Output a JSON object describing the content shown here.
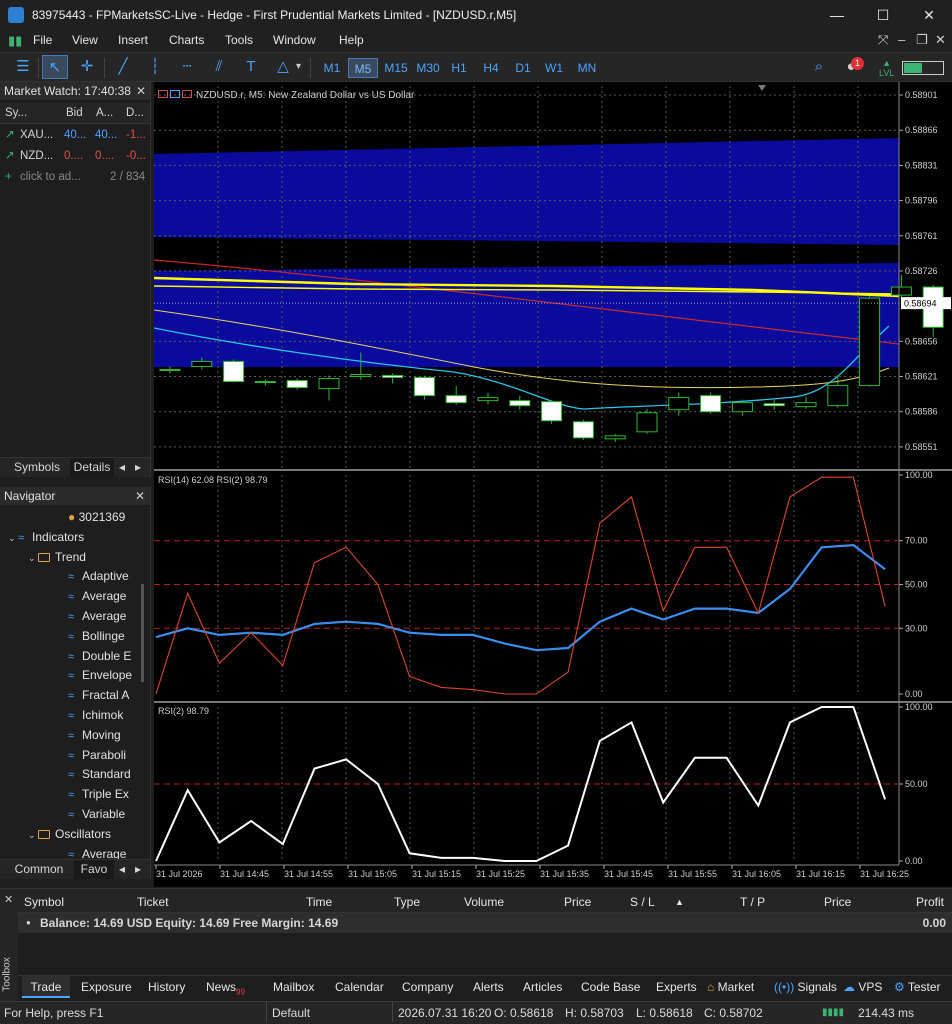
{
  "window": {
    "title": "83975443 - FPMarketsSC-Live - Hedge - First Prudential Markets Limited - [NZDUSD.r,M5]",
    "minimize": "—",
    "maximize": "☐",
    "close": "✕"
  },
  "menu": [
    "File",
    "View",
    "Insert",
    "Charts",
    "Tools",
    "Window",
    "Help"
  ],
  "toolbar": {
    "timeframes": [
      "M1",
      "M5",
      "M15",
      "M30",
      "H1",
      "H4",
      "D1",
      "W1",
      "MN"
    ],
    "selected_timeframe": "M5",
    "notification_count": "1",
    "lvl_label": "LVL"
  },
  "market_watch": {
    "title": "Market Watch: 17:40:38",
    "columns": [
      "Sy...",
      "Bid",
      "A...",
      "D..."
    ],
    "rows": [
      {
        "symbol": "XAU...",
        "bid": "40...",
        "ask": "40...",
        "daily": "-1...",
        "color": "#4aa3ff"
      },
      {
        "symbol": "NZD...",
        "bid": "0....",
        "ask": "0....",
        "daily": "-0...",
        "color": "#e05050"
      }
    ],
    "add_row": "click to ad...",
    "count": "2 / 834",
    "tabs": [
      "Symbols",
      "Details"
    ]
  },
  "navigator": {
    "title": "Navigator",
    "account": "3021369",
    "items": [
      {
        "label": "Indicators",
        "kind": "root"
      },
      {
        "label": "Trend",
        "kind": "folder"
      },
      {
        "label": "Adaptive",
        "kind": "ind"
      },
      {
        "label": "Average",
        "kind": "ind"
      },
      {
        "label": "Average",
        "kind": "ind"
      },
      {
        "label": "Bollinge",
        "kind": "ind"
      },
      {
        "label": "Double E",
        "kind": "ind"
      },
      {
        "label": "Envelope",
        "kind": "ind"
      },
      {
        "label": "Fractal A",
        "kind": "ind"
      },
      {
        "label": "Ichimok",
        "kind": "ind"
      },
      {
        "label": "Moving",
        "kind": "ind"
      },
      {
        "label": "Paraboli",
        "kind": "ind"
      },
      {
        "label": "Standard",
        "kind": "ind"
      },
      {
        "label": "Triple Ex",
        "kind": "ind"
      },
      {
        "label": "Variable",
        "kind": "ind"
      },
      {
        "label": "Oscillators",
        "kind": "folder"
      },
      {
        "label": "Average",
        "kind": "ind"
      }
    ],
    "tabs": [
      "Common",
      "Favo"
    ]
  },
  "chart_data": [
    {
      "type": "candlestick",
      "title": "NZDUSD.r, M5:  New Zealand Dollar vs US Dollar",
      "current_price": "0.58694",
      "y_ticks": [
        "0.58901",
        "0.58866",
        "0.58831",
        "0.58796",
        "0.58761",
        "0.58726",
        "0.58656",
        "0.58621",
        "0.58586",
        "0.58551"
      ],
      "ylim": [
        0.5853,
        0.5891
      ],
      "candles": [
        {
          "o": 0.58627,
          "h": 0.58631,
          "l": 0.58624,
          "c": 0.58628
        },
        {
          "o": 0.58631,
          "h": 0.5864,
          "l": 0.58628,
          "c": 0.58636
        },
        {
          "o": 0.58636,
          "h": 0.58638,
          "l": 0.58615,
          "c": 0.58616
        },
        {
          "o": 0.58616,
          "h": 0.58618,
          "l": 0.58612,
          "c": 0.58615
        },
        {
          "o": 0.58617,
          "h": 0.58619,
          "l": 0.58608,
          "c": 0.5861
        },
        {
          "o": 0.58609,
          "h": 0.58622,
          "l": 0.58597,
          "c": 0.58619
        },
        {
          "o": 0.58621,
          "h": 0.58645,
          "l": 0.58618,
          "c": 0.58623
        },
        {
          "o": 0.58622,
          "h": 0.58624,
          "l": 0.58614,
          "c": 0.5862
        },
        {
          "o": 0.5862,
          "h": 0.58622,
          "l": 0.58598,
          "c": 0.58602
        },
        {
          "o": 0.58602,
          "h": 0.58612,
          "l": 0.58593,
          "c": 0.58595
        },
        {
          "o": 0.58597,
          "h": 0.58605,
          "l": 0.58593,
          "c": 0.586
        },
        {
          "o": 0.58597,
          "h": 0.58602,
          "l": 0.58588,
          "c": 0.58592
        },
        {
          "o": 0.58596,
          "h": 0.58596,
          "l": 0.58574,
          "c": 0.58577
        },
        {
          "o": 0.58576,
          "h": 0.58578,
          "l": 0.58558,
          "c": 0.5856
        },
        {
          "o": 0.58559,
          "h": 0.58564,
          "l": 0.58556,
          "c": 0.58562
        },
        {
          "o": 0.58566,
          "h": 0.58589,
          "l": 0.58564,
          "c": 0.58585
        },
        {
          "o": 0.58588,
          "h": 0.58605,
          "l": 0.58582,
          "c": 0.586
        },
        {
          "o": 0.58602,
          "h": 0.58605,
          "l": 0.58584,
          "c": 0.58586
        },
        {
          "o": 0.58586,
          "h": 0.58598,
          "l": 0.58582,
          "c": 0.58595
        },
        {
          "o": 0.58594,
          "h": 0.58598,
          "l": 0.58588,
          "c": 0.58592
        },
        {
          "o": 0.58591,
          "h": 0.58601,
          "l": 0.58589,
          "c": 0.58595
        },
        {
          "o": 0.58592,
          "h": 0.58622,
          "l": 0.5859,
          "c": 0.58612
        },
        {
          "o": 0.58612,
          "h": 0.58701,
          "l": 0.58611,
          "c": 0.58699
        },
        {
          "o": 0.58702,
          "h": 0.58722,
          "l": 0.58696,
          "c": 0.5871
        },
        {
          "o": 0.5871,
          "h": 0.58712,
          "l": 0.5866,
          "c": 0.5867
        }
      ]
    },
    {
      "type": "line",
      "title": "RSI(14) 62.08 RSI(2) 98.79",
      "y_ticks": [
        "100.00",
        "70.00",
        "50.00",
        "30.00",
        "0.00"
      ],
      "ylim": [
        0,
        100
      ],
      "levels": [
        70,
        50,
        30
      ],
      "series": [
        {
          "color": "#3a8ef0",
          "values": [
            26,
            30,
            27,
            28,
            27,
            32,
            33,
            32,
            28,
            27,
            27,
            23,
            20,
            21,
            33,
            39,
            34,
            39,
            39,
            37,
            48,
            67,
            68,
            57
          ]
        },
        {
          "color": "#d84a2a",
          "values": [
            0,
            46,
            14,
            28,
            13,
            60,
            67,
            50,
            8,
            3,
            2,
            0,
            0,
            10,
            78,
            90,
            38,
            67,
            67,
            37,
            90,
            99,
            99,
            40
          ]
        }
      ]
    },
    {
      "type": "line",
      "title": "RSI(2) 98.79",
      "y_ticks": [
        "100.00",
        "50.00",
        "0.00"
      ],
      "ylim": [
        0,
        100
      ],
      "levels": [
        50
      ],
      "series": [
        {
          "color": "#ffffff",
          "values": [
            0,
            46,
            12,
            26,
            11,
            60,
            66,
            50,
            5,
            2,
            2,
            0,
            0,
            10,
            78,
            90,
            38,
            67,
            67,
            36,
            90,
            100,
            100,
            40
          ]
        }
      ]
    }
  ],
  "x_axis": [
    "31 Jul 2026",
    "31 Jul 14:45",
    "31 Jul 14:55",
    "31 Jul 15:05",
    "31 Jul 15:15",
    "31 Jul 15:25",
    "31 Jul 15:35",
    "31 Jul 15:45",
    "31 Jul 15:55",
    "31 Jul 16:05",
    "31 Jul 16:15",
    "31 Jul 16:25"
  ],
  "toolbox": {
    "columns": [
      "Symbol",
      "Ticket",
      "Time",
      "Type",
      "Volume",
      "Price",
      "S / L",
      "T / P",
      "Price",
      "Profit"
    ],
    "balance_text": "Balance: 14.69 USD  Equity: 14.69  Free Margin: 14.69",
    "profit": "0.00",
    "side_label": "Toolbox",
    "tabs": [
      "Trade",
      "Exposure",
      "History",
      "News",
      "Mailbox",
      "Calendar",
      "Company",
      "Alerts",
      "Articles",
      "Code Base",
      "Experts"
    ],
    "news_badge": "99",
    "right_tabs": [
      "Market",
      "Signals",
      "VPS",
      "Tester"
    ]
  },
  "status": {
    "help": "For Help, press F1",
    "profile": "Default",
    "datetime": "2026.07.31 16:20",
    "open": "O: 0.58618",
    "high": "H: 0.58703",
    "low": "L: 0.58618",
    "close": "C: 0.58702",
    "ping": "214.43 ms"
  }
}
